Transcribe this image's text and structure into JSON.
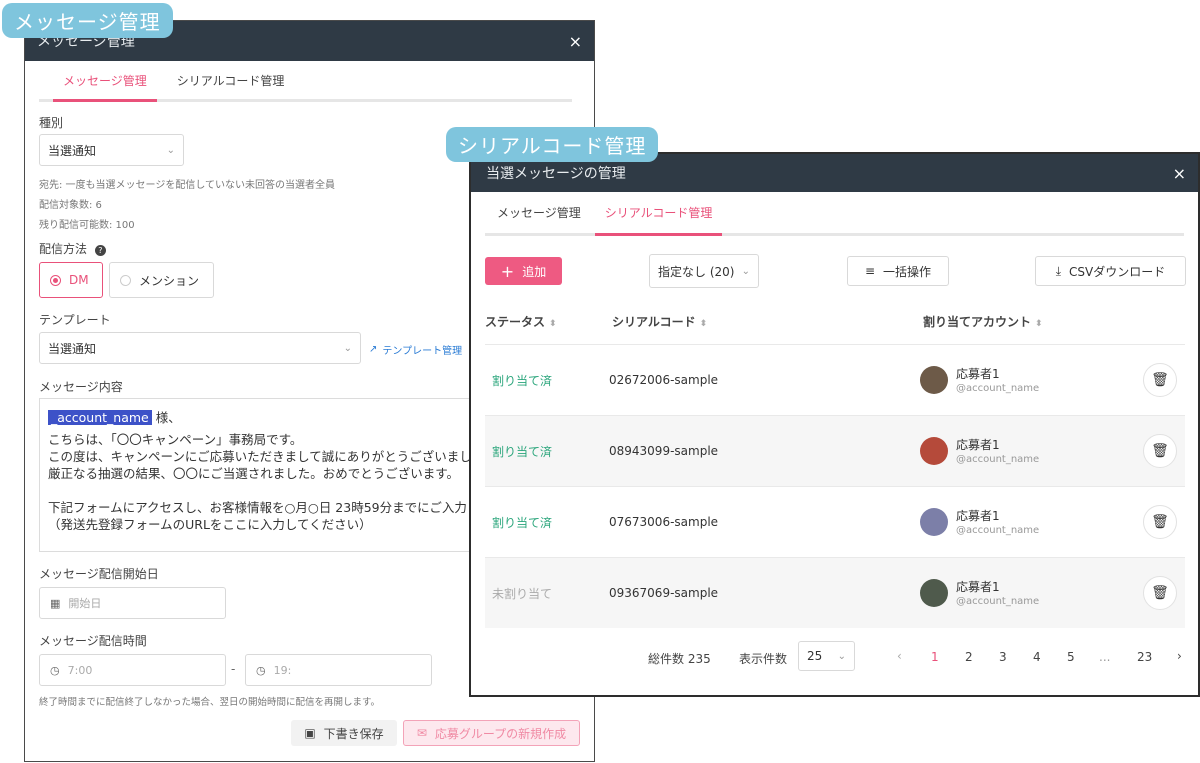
{
  "badges": {
    "left": "メッセージ管理",
    "right": "シリアルコード管理"
  },
  "left": {
    "title": "メッセージ管理",
    "close": "×",
    "tabs": [
      "メッセージ管理",
      "シリアルコード管理"
    ],
    "type_label": "種別",
    "type_value": "当選通知",
    "info1": "宛先: 一度も当選メッセージを配信していない未回答の当選者全員",
    "info2": "配信対象数: 6",
    "info3": "残り配信可能数: 100",
    "method_label": "配信方法",
    "method_dm": "DM",
    "method_mention": "メンション",
    "template_label": "テンプレート",
    "template_value": "当選通知",
    "template_manage": "テンプレート管理",
    "content_label": "メッセージ内容",
    "msg_highlight": "_account_name",
    "msg_suffix": " 様、",
    "msg_line2": "こちらは、「〇〇キャンペーン」事務局です。",
    "msg_line3": "この度は、キャンペーンにご応募いただきまして誠にありがとうございまし",
    "msg_line4": "厳正なる抽選の結果、〇〇にご当選されました。おめでとうございます。",
    "msg_line5": "下記フォームにアクセスし、お客様情報を○月○日 23時59分までにご入力ま",
    "msg_line6": "（発送先登録フォームのURLをここに入力してください）",
    "start_date_label": "メッセージ配信開始日",
    "start_date_placeholder": "開始日",
    "time_label": "メッセージ配信時間",
    "time_start": "7:00",
    "time_sep": "-",
    "time_end": "19:",
    "time_note": "終了時間までに配信終了しなかった場合、翌日の開始時間に配信を再開します。",
    "draft_button": "下書き保存",
    "create_button": "応募グループの新規作成"
  },
  "right": {
    "title": "当選メッセージの管理",
    "close": "×",
    "tabs": [
      "メッセージ管理",
      "シリアルコード管理"
    ],
    "add_button": "追加",
    "filter_value": "指定なし (20)",
    "bulk_button": "一括操作",
    "csv_button": "CSVダウンロード",
    "columns": [
      "ステータス",
      "シリアルコード",
      "割り当てアカウント"
    ],
    "rows": [
      {
        "status": "割り当て済",
        "code": "02672006-sample",
        "name": "応募者1",
        "handle": "@account_name",
        "assigned": true
      },
      {
        "status": "割り当て済",
        "code": "08943099-sample",
        "name": "応募者1",
        "handle": "@account_name",
        "assigned": true
      },
      {
        "status": "割り当て済",
        "code": "07673006-sample",
        "name": "応募者1",
        "handle": "@account_name",
        "assigned": true
      },
      {
        "status": "未割り当て",
        "code": "09367069-sample",
        "name": "応募者1",
        "handle": "@account_name",
        "assigned": false
      }
    ],
    "total": "総件数 235",
    "per_page_label": "表示件数",
    "per_page": "25",
    "pages": [
      "1",
      "2",
      "3",
      "4",
      "5",
      "...",
      "23"
    ]
  },
  "colors": {
    "accent": "#e9517a",
    "titlebar": "#2f3a45",
    "badge": "#7fc5dd",
    "assigned": "#2aa57b"
  }
}
